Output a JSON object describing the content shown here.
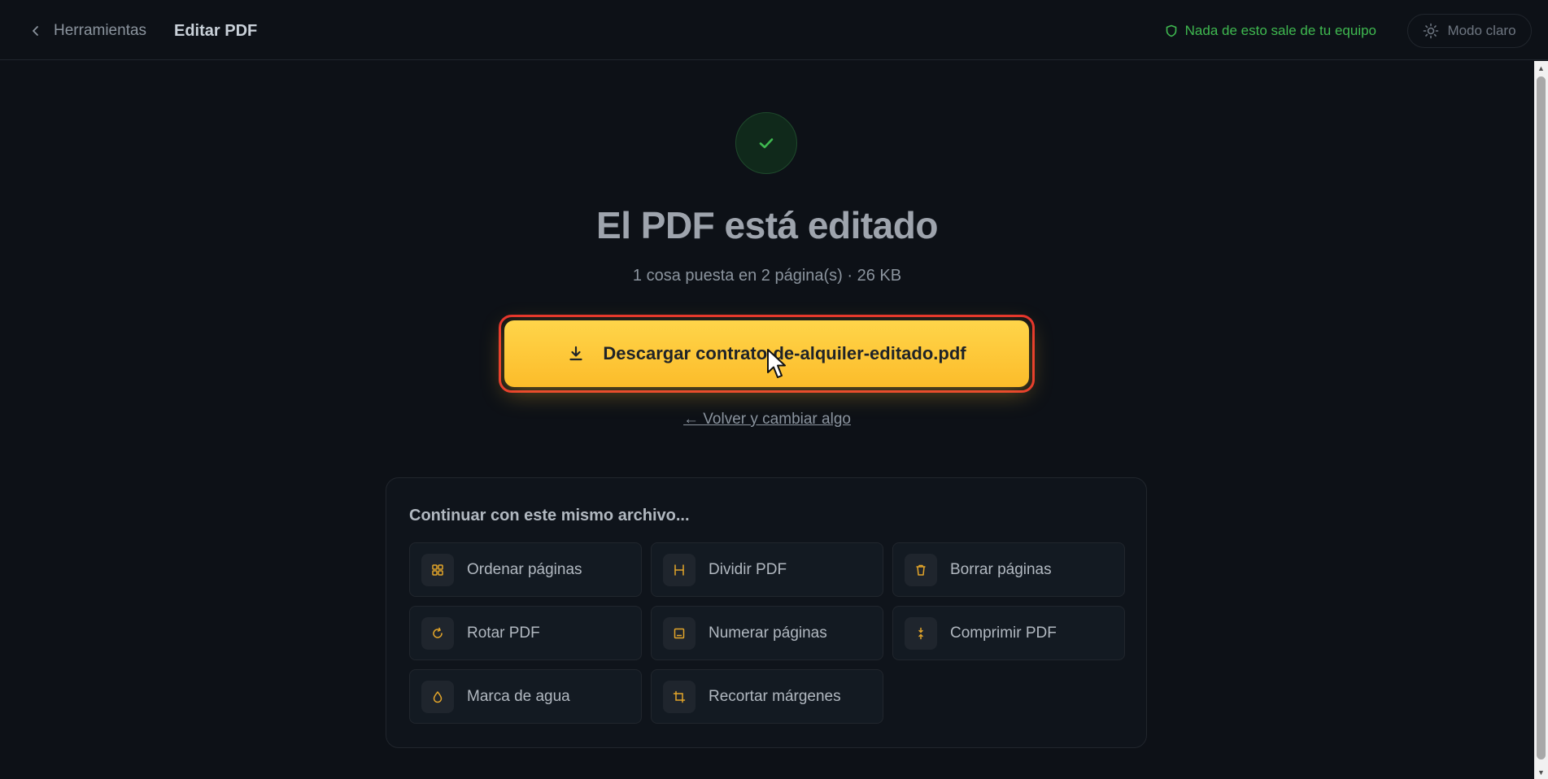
{
  "header": {
    "back_label": "Herramientas",
    "title": "Editar PDF",
    "privacy_note": "Nada de esto sale de tu equipo",
    "theme_toggle_label": "Modo claro"
  },
  "result": {
    "headline": "El PDF está editado",
    "summary": "1 cosa puesta en 2 página(s) · 26 KB",
    "download_label": "Descargar contrato-de-alquiler-editado.pdf",
    "back_change_label": "← Volver y cambiar algo"
  },
  "continue": {
    "title": "Continuar con este mismo archivo...",
    "tools": [
      {
        "label": "Ordenar páginas",
        "icon": "grid-icon"
      },
      {
        "label": "Dividir PDF",
        "icon": "split-icon"
      },
      {
        "label": "Borrar páginas",
        "icon": "trash-icon"
      },
      {
        "label": "Rotar PDF",
        "icon": "rotate-icon"
      },
      {
        "label": "Numerar páginas",
        "icon": "page-number-icon"
      },
      {
        "label": "Comprimir PDF",
        "icon": "compress-icon"
      },
      {
        "label": "Marca de agua",
        "icon": "droplet-icon"
      },
      {
        "label": "Recortar márgenes",
        "icon": "crop-icon"
      }
    ]
  },
  "colors": {
    "background": "#0d1117",
    "accent": "#fcbc2a",
    "success": "#3fb950",
    "highlight": "#e5322d"
  }
}
